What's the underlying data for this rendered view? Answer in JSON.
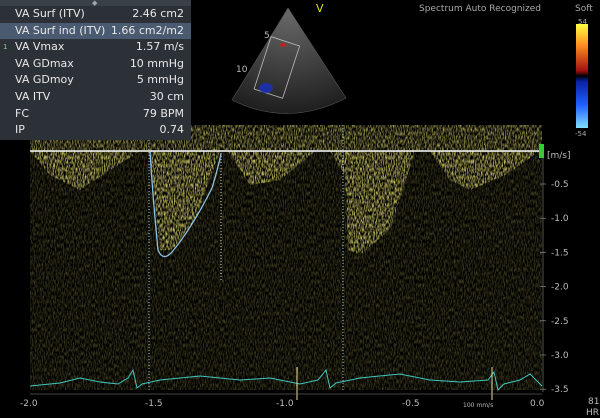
{
  "measurements": [
    {
      "label": "VA Surf (ITV)",
      "value": "2.46 cm2"
    },
    {
      "label": "VA Surf ind (ITV)",
      "value": "1.66 cm2/m2"
    },
    {
      "label": "VA Vmax",
      "value": "1.57 m/s",
      "index": "1"
    },
    {
      "label": "VA GDmax",
      "value": "10 mmHg"
    },
    {
      "label": "VA  GDmoy",
      "value": "5 mmHg"
    },
    {
      "label": "VA ITV",
      "value": "30 cm"
    },
    {
      "label": "FC",
      "value": "79 BPM"
    },
    {
      "label": "IP",
      "value": "0.74"
    }
  ],
  "header": {
    "status": "Spectrum Auto Recognized",
    "preset": "Soft",
    "view_marker": "V"
  },
  "color_scale": {
    "top": "54",
    "bottom": "-54"
  },
  "sector": {
    "depth_marks": [
      "5",
      "10"
    ]
  },
  "spectrum": {
    "unit_label": "[m/s]",
    "y_ticks": [
      "-0.5",
      "-1.0",
      "-1.5",
      "-2.0",
      "-2.5",
      "-3.0",
      "-3.5"
    ],
    "x_ticks": [
      "-2.0",
      "-1.5",
      "-1.0",
      "-0.5",
      "0.0"
    ],
    "sweep_label": "100 mm/s",
    "hr_value": "81",
    "hr_label": "HR"
  },
  "colors": {
    "spectrum": "#e8e040",
    "ecg": "#40c8c0",
    "trace": "#8ec0e8",
    "panel": "#2c3138",
    "selected_row": "#4a5a70"
  }
}
